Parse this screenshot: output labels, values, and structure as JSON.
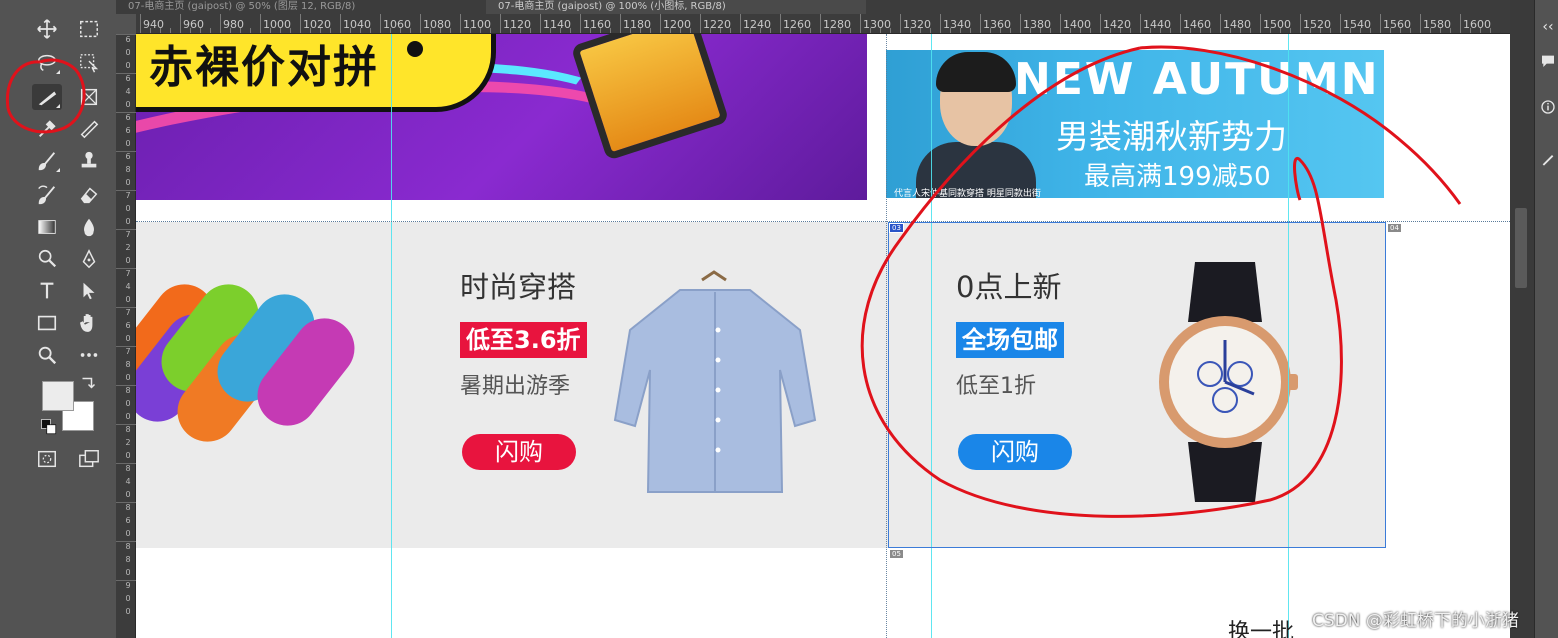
{
  "tabs": [
    {
      "label": "07-电商主页 (gaipost) @ 50% (图层 12, RGB/8)"
    },
    {
      "label": "07-电商主页 (gaipost) @ 100% (小图标, RGB/8)"
    }
  ],
  "ruler_h": [
    "940",
    "960",
    "980",
    "1000",
    "1020",
    "1040",
    "1060",
    "1080",
    "1100",
    "1120",
    "1140",
    "1160",
    "1180",
    "1200",
    "1220",
    "1240",
    "1260",
    "1280",
    "1300",
    "1320",
    "1340",
    "1360",
    "1380",
    "1400",
    "1420",
    "1440",
    "1460",
    "1480",
    "1500",
    "1520",
    "1540",
    "1560",
    "1580",
    "1600"
  ],
  "ruler_v": [
    "6",
    "0",
    "0",
    "6",
    "4",
    "0",
    "6",
    "6",
    "0",
    "6",
    "8",
    "0",
    "7",
    "0",
    "0",
    "7",
    "2",
    "0",
    "7",
    "4",
    "0",
    "7",
    "6",
    "0",
    "7",
    "8",
    "0",
    "8",
    "0",
    "0",
    "8",
    "2",
    "0",
    "8",
    "4",
    "0",
    "8",
    "6",
    "0",
    "8",
    "8",
    "0",
    "9",
    "0",
    "0"
  ],
  "banners": {
    "purple_text": "赤裸价对拼",
    "autumn_title": "NEW AUTUMN",
    "autumn_sub": "男装潮秋新势力",
    "autumn_deal": "最高满199减50",
    "autumn_caption": "代言人宋仲基同款穿搭 明星同款出街"
  },
  "cards": [
    {
      "title": "时尚穿搭",
      "badge": "低至3.6折",
      "subtitle": "暑期出游季",
      "button": "闪购",
      "badge_color": "#e8143e",
      "button_color": "#e8143e"
    },
    {
      "title": "0点上新",
      "badge": "全场包邮",
      "subtitle": "低至1折",
      "button": "闪购",
      "badge_color": "#1a86e8",
      "button_color": "#1a86e8"
    }
  ],
  "slices": [
    "03",
    "04",
    "05"
  ],
  "switch_text": "换一批",
  "watermark": "CSDN @彩虹桥下的小浙猪",
  "colors": {
    "annotation_red": "#e0121b",
    "guide_cyan": "#4fe3ef",
    "slice_blue": "#3b7bd8"
  }
}
